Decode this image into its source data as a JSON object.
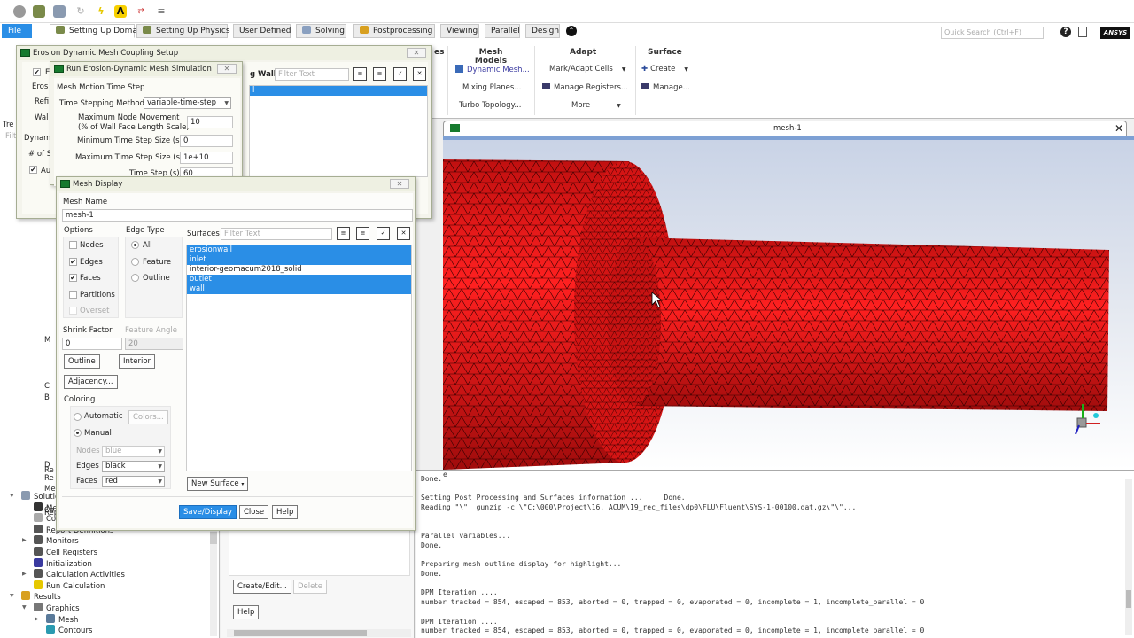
{
  "quick_access_icons": [
    "sphere-icon",
    "mesh-settings-icon",
    "solver-icon",
    "refresh-icon",
    "lightning-icon",
    "ansys-a-icon",
    "parallel-icon",
    "menu-lines-icon"
  ],
  "ribbon_tabs": [
    {
      "label": "File",
      "icon": null,
      "state": "file"
    },
    {
      "label": "Setting Up Domain",
      "icon": "domain-icon",
      "state": "active"
    },
    {
      "label": "Setting Up Physics",
      "icon": "physics-icon",
      "state": ""
    },
    {
      "label": "User Defined",
      "icon": null,
      "state": ""
    },
    {
      "label": "Solving",
      "icon": "solving-icon",
      "state": ""
    },
    {
      "label": "Postprocessing",
      "icon": "postprocessing-icon",
      "state": ""
    },
    {
      "label": "Viewing",
      "icon": null,
      "state": ""
    },
    {
      "label": "Parallel",
      "icon": null,
      "state": ""
    },
    {
      "label": "Design",
      "icon": null,
      "state": ""
    }
  ],
  "quick_search_placeholder": "Quick Search (Ctrl+F)",
  "brand": "ANSYS",
  "ribbon": {
    "partial_title": "es",
    "mesh_models": {
      "title": "Mesh Models",
      "items": [
        "Dynamic Mesh...",
        "Mixing Planes...",
        "Turbo Topology..."
      ]
    },
    "adapt": {
      "title": "Adapt",
      "items": [
        "Mark/Adapt Cells",
        "Manage Registers...",
        "More"
      ]
    },
    "surface": {
      "title": "Surface",
      "items": [
        "Create",
        "Manage..."
      ]
    }
  },
  "graphics": {
    "tab_title": "mesh-1",
    "mesh_color": "#e01818",
    "edge_color": "#000000"
  },
  "console": {
    "title_fragment": "e",
    "lines": [
      "Done.",
      "",
      "Setting Post Processing and Surfaces information ...     Done.",
      "Reading \"\\\"| gunzip -c \\\"C:\\000\\Project\\16. ACUM\\19_rec_files\\dp0\\FLU\\Fluent\\SYS-1-00100.dat.gz\\\"\\\"...",
      "",
      "",
      "Parallel variables...",
      "Done.",
      "",
      "Preparing mesh outline display for highlight...",
      "Done.",
      "",
      "DPM Iteration ....",
      "number tracked = 854, escaped = 853, aborted = 0, trapped = 0, evaporated = 0, incomplete = 1, incomplete_parallel = 0",
      "",
      "DPM Iteration ....",
      "number tracked = 854, escaped = 853, aborted = 0, trapped = 0, evaporated = 0, incomplete = 1, incomplete_parallel = 0"
    ]
  },
  "tree": {
    "partial_header": "Tre",
    "partial_filter": "Filt",
    "nodes": [
      {
        "label": "Solution",
        "level": 0,
        "expanded": true,
        "icon": "solution-icon"
      },
      {
        "label": "Methods",
        "level": 1,
        "icon": "methods-icon"
      },
      {
        "label": "Controls",
        "level": 1,
        "icon": "controls-icon"
      },
      {
        "label": "Report Definitions",
        "level": 1,
        "icon": "report-icon"
      },
      {
        "label": "Monitors",
        "level": 1,
        "collapsed": true,
        "icon": "monitors-icon"
      },
      {
        "label": "Cell Registers",
        "level": 1,
        "icon": "cell-registers-icon"
      },
      {
        "label": "Initialization",
        "level": 1,
        "icon": "initialization-icon"
      },
      {
        "label": "Calculation Activities",
        "level": 1,
        "collapsed": true,
        "icon": "calculation-activities-icon"
      },
      {
        "label": "Run Calculation",
        "level": 1,
        "icon": "run-calculation-icon"
      },
      {
        "label": "Results",
        "level": 0,
        "expanded": true,
        "icon": "results-icon"
      },
      {
        "label": "Graphics",
        "level": 1,
        "expanded": true,
        "icon": "graphics-icon"
      },
      {
        "label": "Mesh",
        "level": 2,
        "collapsed": true,
        "icon": "mesh-icon"
      },
      {
        "label": "Contours",
        "level": 2,
        "icon": "contours-icon"
      }
    ],
    "truncated": [
      "M",
      "C",
      "B",
      "D",
      "Re",
      "Re",
      "Me",
      "Co",
      "Rep"
    ]
  },
  "task_panel": {
    "create_edit": "Create/Edit...",
    "delete": "Delete",
    "help": "Help"
  },
  "dlg_coupling": {
    "title": "Erosion Dynamic Mesh Coupling Setup",
    "partials": [
      "E",
      "Eros",
      "Refi",
      "Wal",
      "Dynam",
      "# of S",
      "Au"
    ],
    "walls_label_partial": "g Walls",
    "filter_placeholder": "Filter Text",
    "selected_item_partial": "l"
  },
  "dlg_run": {
    "title": "Run Erosion-Dynamic Mesh Simulation",
    "section": "Mesh Motion Time Step",
    "method_label": "Time Stepping Method",
    "method_value": "variable-time-step",
    "max_node_label_1": "Maximum Node Movement",
    "max_node_label_2": "(% of Wall Face Length Scale)",
    "max_node_value": "10",
    "min_step_label": "Minimum Time Step Size (s)",
    "min_step_value": "0",
    "max_step_label": "Maximum Time Step Size (s)",
    "max_step_value": "1e+10",
    "time_step_label": "Time Step (s)",
    "time_step_value": "60"
  },
  "dlg_mesh": {
    "title": "Mesh Display",
    "mesh_name_label": "Mesh Name",
    "mesh_name_value": "mesh-1",
    "options_label": "Options",
    "options": [
      {
        "label": "Nodes",
        "checked": false,
        "disabled": false
      },
      {
        "label": "Edges",
        "checked": true,
        "disabled": false
      },
      {
        "label": "Faces",
        "checked": true,
        "disabled": false
      },
      {
        "label": "Partitions",
        "checked": false,
        "disabled": false
      },
      {
        "label": "Overset",
        "checked": false,
        "disabled": true
      }
    ],
    "edge_type_label": "Edge Type",
    "edge_types": [
      {
        "label": "All",
        "selected": true
      },
      {
        "label": "Feature",
        "selected": false
      },
      {
        "label": "Outline",
        "selected": false
      }
    ],
    "surfaces_label": "Surfaces",
    "surfaces_filter_placeholder": "Filter Text",
    "surfaces": [
      {
        "label": "erosionwall",
        "selected": true
      },
      {
        "label": "inlet",
        "selected": true
      },
      {
        "label": "interior-geomacum2018_solid",
        "selected": false
      },
      {
        "label": "outlet",
        "selected": true
      },
      {
        "label": "wall",
        "selected": true
      }
    ],
    "shrink_label": "Shrink Factor",
    "shrink_value": "0",
    "feature_angle_label": "Feature Angle",
    "feature_angle_value": "20",
    "outline_btn": "Outline",
    "interior_btn": "Interior",
    "adjacency_btn": "Adjacency...",
    "coloring_label": "Coloring",
    "automatic_label": "Automatic",
    "manual_label": "Manual",
    "coloring_mode": "Manual",
    "colors_btn": "Colors...",
    "nodes_label": "Nodes",
    "nodes_value": "blue",
    "edges_label": "Edges",
    "edges_value": "black",
    "faces_label": "Faces",
    "faces_value": "red",
    "new_surface_btn": "New Surface",
    "save_btn": "Save/Display",
    "close_btn": "Close",
    "help_btn": "Help"
  }
}
